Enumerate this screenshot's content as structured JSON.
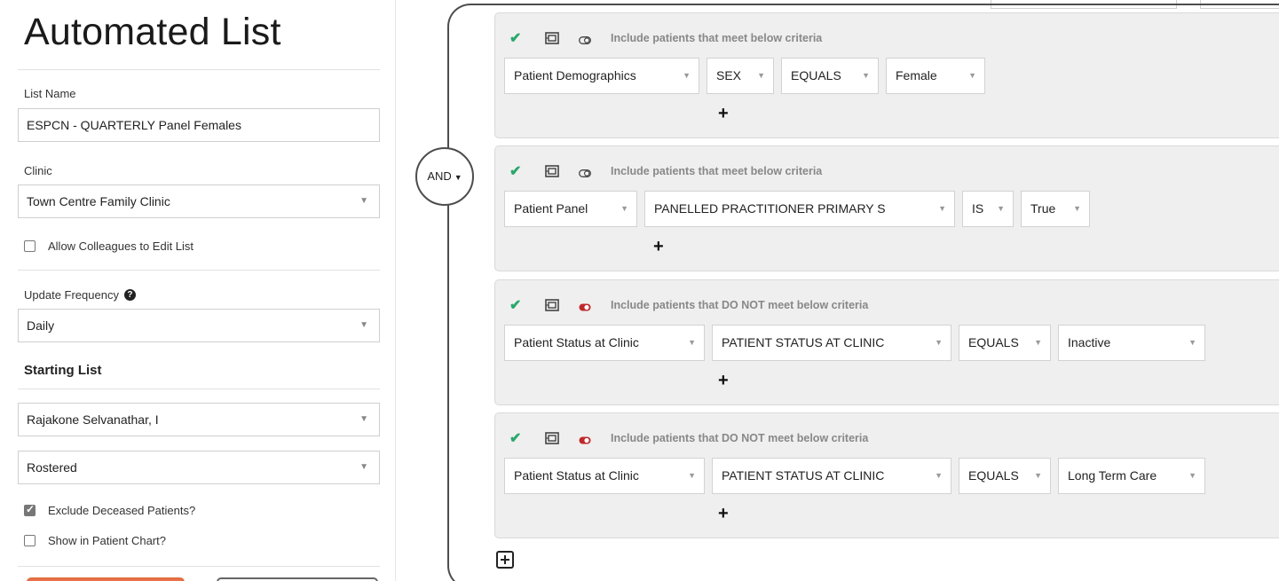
{
  "page": {
    "title": "Automated List"
  },
  "list_name": {
    "label": "List Name",
    "value": "ESPCN - QUARTERLY Panel Females"
  },
  "clinic": {
    "label": "Clinic",
    "value": "Town Centre Family Clinic"
  },
  "allow_colleagues": {
    "label": "Allow Colleagues to Edit List",
    "checked": false
  },
  "update_frequency": {
    "label": "Update Frequency",
    "help_icon": "question-circle-icon",
    "value": "Daily"
  },
  "starting_list": {
    "heading": "Starting List",
    "practitioner": "Rajakone Selvanathar, I",
    "status": "Rostered"
  },
  "exclude_deceased": {
    "label": "Exclude Deceased Patients?",
    "checked": true
  },
  "show_in_chart": {
    "label": "Show in Patient Chart?",
    "checked": false
  },
  "group": {
    "operator": "AND"
  },
  "criteria": [
    {
      "mode_text": "Include patients that meet below criteria",
      "include": true,
      "fields": [
        "Patient Demographics",
        "SEX",
        "EQUALS",
        "Female"
      ]
    },
    {
      "mode_text": "Include patients that meet below criteria",
      "include": true,
      "fields": [
        "Patient Panel",
        "PANELLED PRACTITIONER PRIMARY S",
        "IS",
        "True"
      ]
    },
    {
      "mode_text": "Include patients that DO NOT meet below criteria",
      "include": false,
      "fields": [
        "Patient Status at Clinic",
        "PATIENT STATUS AT CLINIC",
        "EQUALS",
        "Inactive"
      ]
    },
    {
      "mode_text": "Include patients that DO NOT meet below criteria",
      "include": false,
      "fields": [
        "Patient Status at Clinic",
        "PATIENT STATUS AT CLINIC",
        "EQUALS",
        "Long Term Care"
      ]
    }
  ],
  "icons": {
    "check": "check-icon",
    "frame": "frame-icon",
    "toggle_on": "toggle-on-icon",
    "toggle_off": "toggle-off-icon",
    "add": "plus-icon",
    "add_group": "plus-square-icon",
    "caret": "caret-down-icon"
  },
  "colors": {
    "check": "#2aa86b",
    "exclude_toggle": "#c0292b",
    "primary_button": "#e8734a"
  }
}
